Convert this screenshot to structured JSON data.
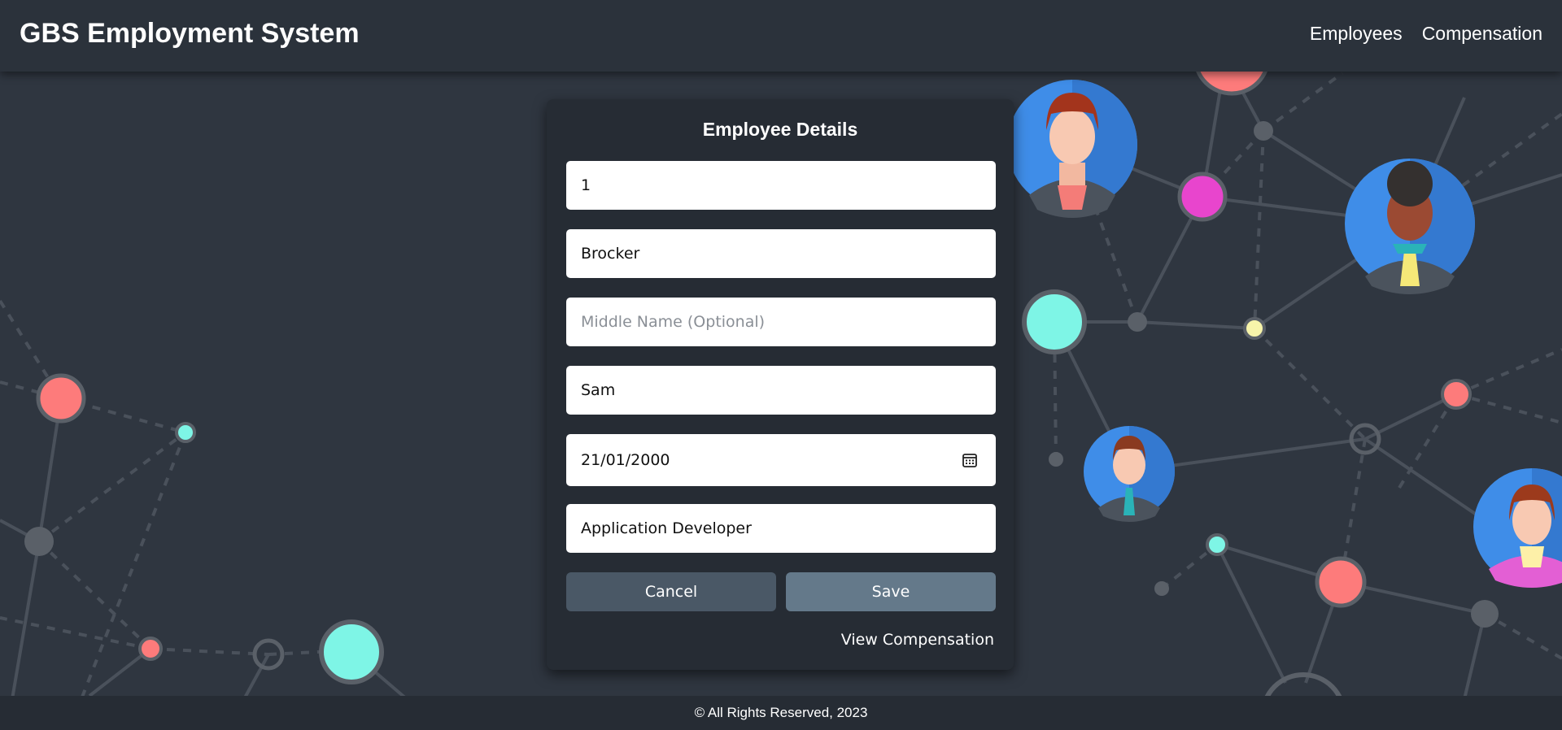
{
  "header": {
    "brand": "GBS Employment System",
    "nav": {
      "employees": "Employees",
      "compensation": "Compensation"
    }
  },
  "form": {
    "title": "Employee Details",
    "employee_number": {
      "value": "1"
    },
    "last_name": {
      "value": "Brocker"
    },
    "middle_name": {
      "value": "",
      "placeholder": "Middle Name (Optional)"
    },
    "first_name": {
      "value": "Sam"
    },
    "birth_date": {
      "value": "21/01/2000",
      "icon": "calendar-icon"
    },
    "position": {
      "value": "Application Developer"
    },
    "cancel_label": "Cancel",
    "save_label": "Save",
    "view_compensation_label": "View Compensation"
  },
  "footer": {
    "text": "© All Rights Reserved, 2023"
  },
  "colors": {
    "background": "#2f3640",
    "header": "#2b323b",
    "card": "#262c34",
    "cancel_button": "#4a5866",
    "save_button": "#64798a",
    "node_coral": "#fd7b7b",
    "node_aqua": "#7ef5e6",
    "node_magenta": "#e845cd",
    "node_yellow": "#f7f4aa",
    "avatar_blue": "#3f8de8"
  }
}
